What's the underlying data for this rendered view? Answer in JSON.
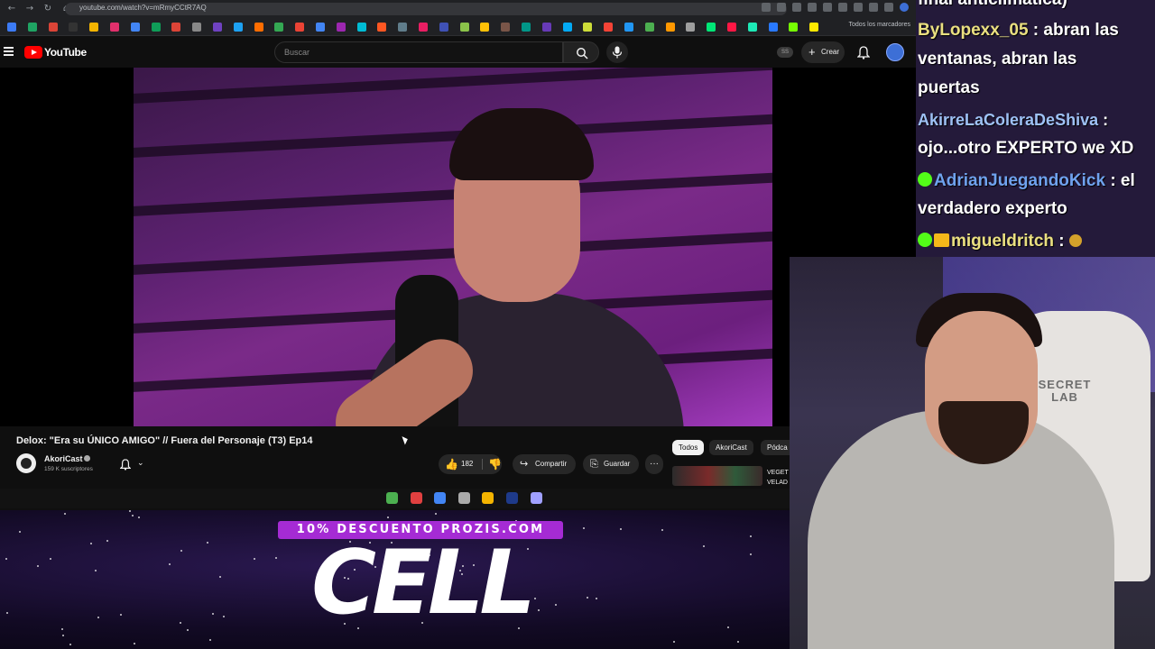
{
  "browser": {
    "url": "youtube.com/watch?v=mRmyCCtR7AQ",
    "bookmarks_label": "Todos los marcadores",
    "bookmark_colors": [
      "#3c7bf4",
      "#1fa463",
      "#db4437",
      "#333",
      "#f4b400",
      "#e1306c",
      "#4285f4",
      "#0f9d58",
      "#db4437",
      "#888",
      "#6f42c1",
      "#1da1f2",
      "#ff6d00",
      "#34a853",
      "#ea4335",
      "#4285f4",
      "#9c27b0",
      "#00bcd4",
      "#ff5722",
      "#607d8b",
      "#e91e63",
      "#3f51b5",
      "#8bc34a",
      "#ffc107",
      "#795548",
      "#009688",
      "#673ab7",
      "#03a9f4",
      "#cddc39",
      "#f44336",
      "#2196f3",
      "#4caf50",
      "#ff9800",
      "#9e9e9e",
      "#00e676",
      "#ff1744",
      "#1de9b6",
      "#2979ff",
      "#76ff03",
      "#ffea00"
    ]
  },
  "youtube": {
    "logo_text": "YouTube",
    "search_placeholder": "Buscar",
    "ss_label": "SS",
    "create_label": "Crear",
    "video": {
      "title": "Delox: \"Era su ÚNICO AMIGO\" // Fuera del Personaje (T3) Ep14",
      "channel": "AkoriCast",
      "subscribers": "159 K suscriptores",
      "likes": "182",
      "share_label": "Compartir",
      "save_label": "Guardar",
      "more_label": "···"
    },
    "chips": [
      "Todos",
      "AkoriCast",
      "Pódca"
    ],
    "related_text": "VEGET\nVELAD"
  },
  "taskbar": {
    "icon_colors": [
      "#4cb050",
      "#e04040",
      "#4285f4",
      "#aaaaaa",
      "#f4b400",
      "#1e3a8a",
      "#a0a0ff"
    ]
  },
  "promo": {
    "discount_text": "10% DESCUENTO PROZIS.COM",
    "code": "CELL"
  },
  "chat": {
    "messages": [
      {
        "user": "",
        "text": "final anticlimática)"
      },
      {
        "user": "ByLopexx_05",
        "text": ": abran las"
      },
      {
        "user": "",
        "text": "ventanas, abran las"
      },
      {
        "user": "",
        "text": "puertas"
      },
      {
        "user": "AkirreLaColeraDeShiva",
        "text": ":"
      },
      {
        "user": "",
        "text": "ojo...otro EXPERTO we XD"
      },
      {
        "user": "AdrianJuegandoKick",
        "text": ": el"
      },
      {
        "user": "",
        "text": "verdadero experto"
      },
      {
        "user": "migueldritch",
        "text": ":"
      }
    ]
  },
  "cam": {
    "chair_brand": "SECRET\nLAB"
  }
}
